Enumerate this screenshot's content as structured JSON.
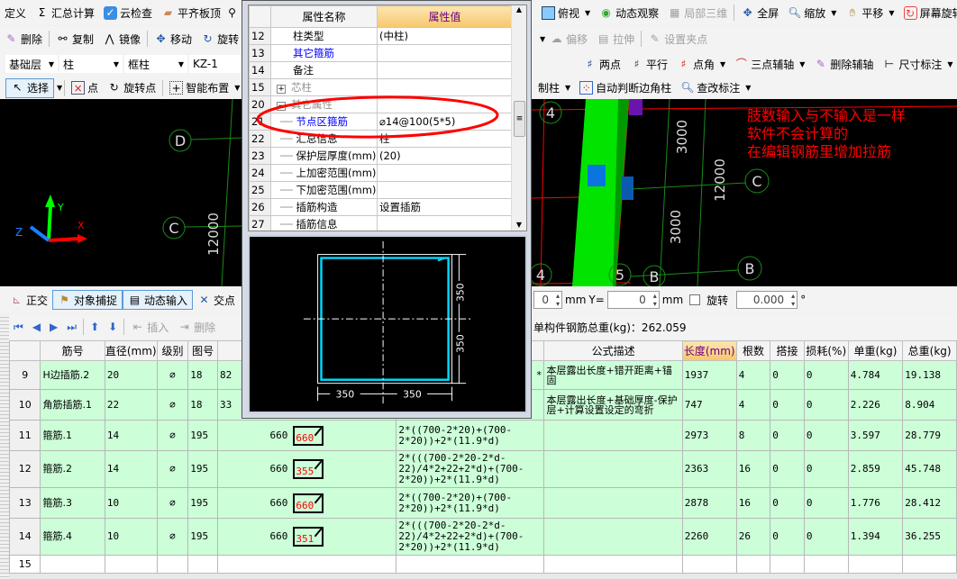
{
  "toolbar1": {
    "left": [
      {
        "label": "定义",
        "icon": "define-icon"
      },
      {
        "label": "汇总计算",
        "icon": "sigma-icon"
      },
      {
        "label": "云检查",
        "icon": "cloud-check-icon"
      },
      {
        "label": "平齐板顶",
        "icon": "align-slab-icon"
      }
    ],
    "right": [
      {
        "label": "俯视",
        "icon": "top-view-icon"
      },
      {
        "label": "动态观察",
        "icon": "orbit-icon"
      },
      {
        "label": "局部三维",
        "icon": "local-3d-icon",
        "disabled": true
      },
      {
        "label": "全屏",
        "icon": "fullscreen-icon"
      },
      {
        "label": "缩放",
        "icon": "zoom-icon"
      },
      {
        "label": "平移",
        "icon": "pan-icon"
      },
      {
        "label": "屏幕旋转",
        "icon": "screen-rotate-icon"
      }
    ]
  },
  "toolbar2": {
    "left": [
      {
        "label": "删除"
      },
      {
        "label": "复制"
      },
      {
        "label": "镜像"
      },
      {
        "label": "移动"
      },
      {
        "label": "旋转"
      }
    ],
    "right": [
      {
        "label": "偏移"
      },
      {
        "label": "拉伸"
      },
      {
        "label": "设置夹点"
      }
    ]
  },
  "toolbar3": {
    "floor": "基础层",
    "type": "柱",
    "subtype": "框柱",
    "component": "KZ-1",
    "right": [
      {
        "label": "两点"
      },
      {
        "label": "平行"
      },
      {
        "label": "点角"
      },
      {
        "label": "三点辅轴"
      },
      {
        "label": "删除辅轴"
      },
      {
        "label": "尺寸标注"
      }
    ]
  },
  "toolbar4": {
    "left": [
      {
        "label": "选择"
      },
      {
        "label": "点"
      },
      {
        "label": "旋转点"
      },
      {
        "label": "智能布置"
      }
    ],
    "right": [
      {
        "label": "制柱"
      },
      {
        "label": "自动判断边角柱"
      },
      {
        "label": "查改标注"
      }
    ]
  },
  "cad": {
    "axis_labels": {
      "x": "X",
      "y": "Y",
      "z": "Z"
    },
    "left": {
      "grid_d": "D",
      "grid_c": "C",
      "dim": "12000"
    },
    "right": {
      "grid_c": "C",
      "grid_b": "B",
      "grid_b2": "B",
      "grid_4a": "4",
      "grid_4b": "4",
      "grid_5": "5",
      "dim1": "3000",
      "dim2": "3000",
      "dim3": "12000"
    },
    "annotation": [
      "肢数输入与不输入是一样",
      "软件不会计算的",
      "在编辑钢筋里增加拉筋"
    ],
    "annotation_color": "#ff0000"
  },
  "popup": {
    "header": {
      "name": "属性名称",
      "value": "属性值"
    },
    "rows": [
      {
        "num": "12",
        "name": "柱类型",
        "value": "(中柱)",
        "indent": 0
      },
      {
        "num": "13",
        "name": "其它箍筋",
        "value": "",
        "indent": 0,
        "style": "blue"
      },
      {
        "num": "14",
        "name": "备注",
        "value": "",
        "indent": 0
      },
      {
        "num": "15",
        "name": "芯柱",
        "value": "",
        "indent": 0,
        "style": "gray",
        "expander": "+"
      },
      {
        "num": "20",
        "name": "其它属性",
        "value": "",
        "indent": 0,
        "style": "gray",
        "expander": "−"
      },
      {
        "num": "21",
        "name": "节点区箍筋",
        "value": "⌀14@100(5*5)",
        "indent": 1,
        "style": "blue"
      },
      {
        "num": "22",
        "name": "汇总信息",
        "value": "柱",
        "indent": 1
      },
      {
        "num": "23",
        "name": "保护层厚度(mm)",
        "value": "(20)",
        "indent": 1
      },
      {
        "num": "24",
        "name": "上加密范围(mm)",
        "value": "",
        "indent": 1
      },
      {
        "num": "25",
        "name": "下加密范围(mm)",
        "value": "",
        "indent": 1
      },
      {
        "num": "26",
        "name": "插筋构造",
        "value": "设置插筋",
        "indent": 1
      },
      {
        "num": "27",
        "name": "插筋信息",
        "value": "",
        "indent": 1
      }
    ],
    "section": {
      "dim_v1": "350",
      "dim_v2": "350",
      "dim_h1": "350",
      "dim_h2": "350"
    }
  },
  "statusbar": {
    "ortho": "正交",
    "snap": "对象捕捉",
    "dynamic_input": "动态输入",
    "intersection": "交点",
    "x_value": "0",
    "mm1": "mm",
    "y_label": "Y=",
    "y_value": "0",
    "mm2": "mm",
    "rotate_label": "旋转",
    "rotate_value": "0.000",
    "degree": "°"
  },
  "rebar_toolbar": {
    "insert": "插入",
    "delete": "删除",
    "total_weight": "单构件钢筋总重(kg)：262.059"
  },
  "table": {
    "headers": [
      "筋号",
      "直径(mm)",
      "级别",
      "图号",
      "",
      "",
      "公式描述",
      "长度(mm)",
      "根数",
      "搭接",
      "损耗(%)",
      "单重(kg)",
      "总重(kg)"
    ],
    "rows": [
      {
        "n": "9",
        "name": "H边插筋.2",
        "dia": "20",
        "grade": "⌀",
        "fig": "18",
        "shape_val": "82",
        "shape_label": "",
        "formula": "*",
        "desc": "本层露出长度+错开距离+锚固",
        "len": "1937",
        "count": "4",
        "lap": "0",
        "loss": "0",
        "unit": "4.784",
        "total": "19.138"
      },
      {
        "n": "10",
        "name": "角筋插筋.1",
        "dia": "22",
        "grade": "⌀",
        "fig": "18",
        "shape_val": "33",
        "shape_label": "",
        "formula": "",
        "desc": "本层露出长度+基础厚度-保护层+计算设置设定的弯折",
        "len": "747",
        "count": "4",
        "lap": "0",
        "loss": "0",
        "unit": "2.226",
        "total": "8.904"
      },
      {
        "n": "11",
        "name": "箍筋.1",
        "dia": "14",
        "grade": "⌀",
        "fig": "195",
        "shape_val": "660",
        "shape_label": "660",
        "formula": "2*((700-2*20)+(700-2*20))+2*(11.9*d)",
        "desc": "",
        "len": "2973",
        "count": "8",
        "lap": "0",
        "loss": "0",
        "unit": "3.597",
        "total": "28.779"
      },
      {
        "n": "12",
        "name": "箍筋.2",
        "dia": "14",
        "grade": "⌀",
        "fig": "195",
        "shape_val": "660",
        "shape_label": "355",
        "formula": "2*(((700-2*20-2*d-22)/4*2+22+2*d)+(700-2*20))+2*(11.9*d)",
        "desc": "",
        "len": "2363",
        "count": "16",
        "lap": "0",
        "loss": "0",
        "unit": "2.859",
        "total": "45.748"
      },
      {
        "n": "13",
        "name": "箍筋.3",
        "dia": "10",
        "grade": "⌀",
        "fig": "195",
        "shape_val": "660",
        "shape_label": "660",
        "formula": "2*((700-2*20)+(700-2*20))+2*(11.9*d)",
        "desc": "",
        "len": "2878",
        "count": "16",
        "lap": "0",
        "loss": "0",
        "unit": "1.776",
        "total": "28.412"
      },
      {
        "n": "14",
        "name": "箍筋.4",
        "dia": "10",
        "grade": "⌀",
        "fig": "195",
        "shape_val": "660",
        "shape_label": "351",
        "formula": "2*(((700-2*20-2*d-22)/4*2+22+2*d)+(700-2*20))+2*(11.9*d)",
        "desc": "",
        "len": "2260",
        "count": "26",
        "lap": "0",
        "loss": "0",
        "unit": "1.394",
        "total": "36.255"
      },
      {
        "n": "15",
        "name": "",
        "dia": "",
        "grade": "",
        "fig": "",
        "shape_val": "",
        "shape_label": "",
        "formula": "",
        "desc": "",
        "len": "",
        "count": "",
        "lap": "",
        "loss": "",
        "unit": "",
        "total": ""
      }
    ]
  }
}
